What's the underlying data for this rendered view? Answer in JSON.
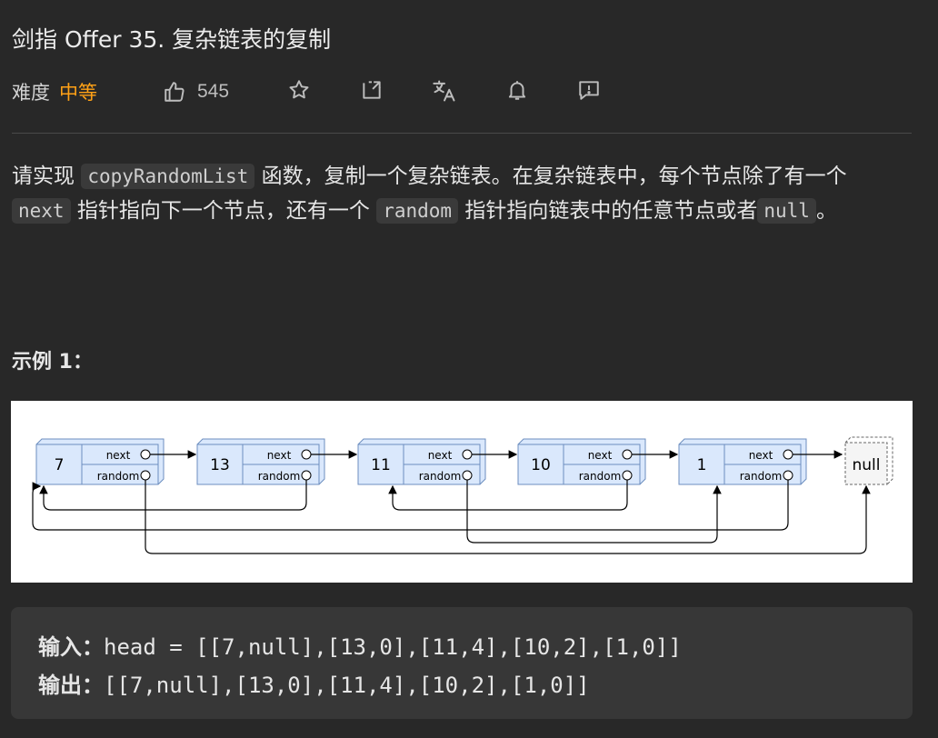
{
  "title": "剑指 Offer 35. 复杂链表的复制",
  "meta": {
    "difficulty_label": "难度",
    "difficulty_value": "中等",
    "likes": "545",
    "icons": [
      "thumbs-up-icon",
      "star-icon",
      "share-icon",
      "translate-icon",
      "bell-icon",
      "feedback-icon"
    ]
  },
  "colors": {
    "difficulty": "#ffa116",
    "background": "#282828",
    "node_fill": "#dae8fc",
    "node_stroke": "#6c8ebf"
  },
  "description": {
    "p1": "请实现",
    "c1": "copyRandomList",
    "p2": "函数，复制一个复杂链表。在复杂链表中，每个节点除了有一个",
    "c2": "next",
    "p3": "指针指向下一个节点，还有一个",
    "c3": "random",
    "p4": "指针指向链表中的任意节点或者",
    "c4": "null",
    "p5": "。"
  },
  "example_title": "示例 1：",
  "diagram": {
    "nodes": [
      "7",
      "13",
      "11",
      "10",
      "1"
    ],
    "next_label": "next",
    "random_label": "random",
    "null_label": "null"
  },
  "example": {
    "input_label": "输入：",
    "input_value": "head = [[7,null],[13,0],[11,4],[10,2],[1,0]]",
    "output_label": "输出：",
    "output_value": "[[7,null],[13,0],[11,4],[10,2],[1,0]]"
  }
}
